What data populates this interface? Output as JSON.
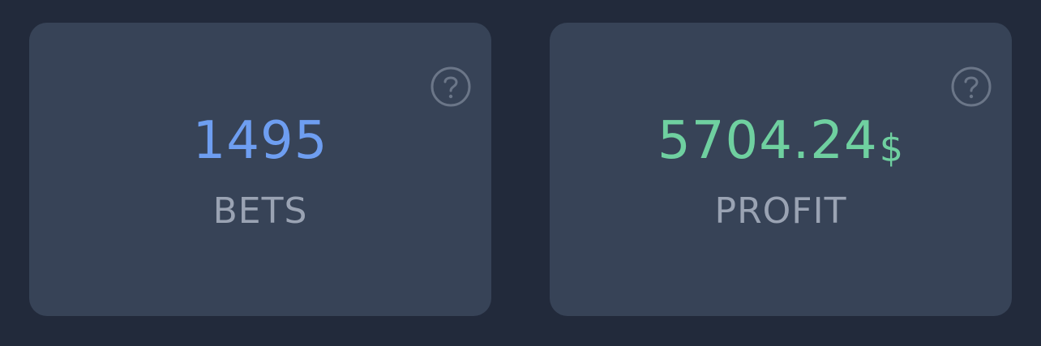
{
  "colors": {
    "page_background": "#222a3b",
    "card_background": "#374357",
    "bets_value": "#6e9ef1",
    "profit_value": "#6fd0a0",
    "label": "#9aa3b3",
    "help_icon": "#6b7688"
  },
  "cards": {
    "bets": {
      "value": "1495",
      "label": "BETS",
      "icon": "question-circle-icon"
    },
    "profit": {
      "value": "5704.24",
      "unit": "$",
      "label": "PROFIT",
      "icon": "question-circle-icon"
    }
  }
}
